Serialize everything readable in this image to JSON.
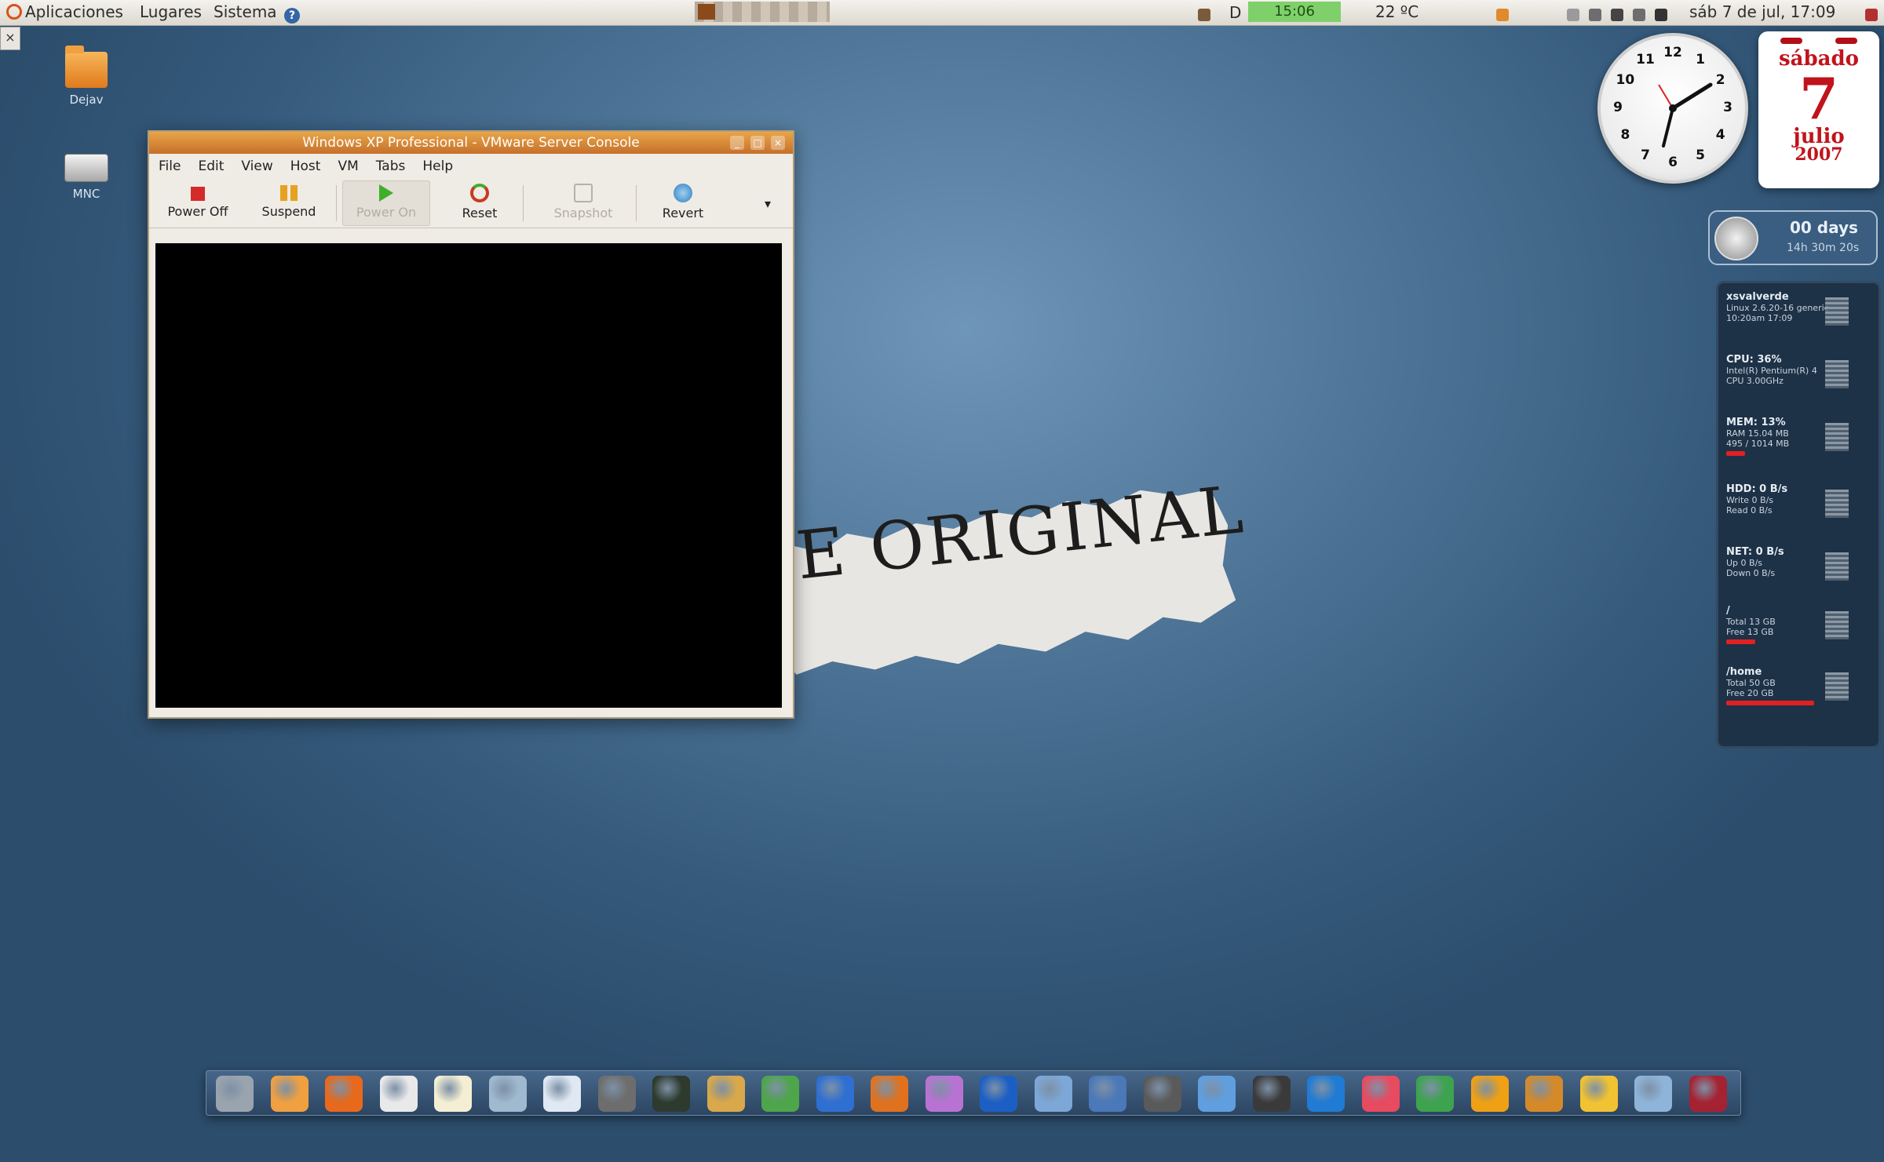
{
  "top_panel": {
    "menus": [
      "Aplicaciones",
      "Lugares",
      "Sistema"
    ],
    "net_speed": "15:06",
    "weather": "22 ºC",
    "datetime": "sáb  7 de jul, 17:09"
  },
  "desktop_icons": [
    {
      "label": "Dejav",
      "icon": "folder-icon"
    },
    {
      "label": "MNC",
      "icon": "drive-icon"
    }
  ],
  "vm_window": {
    "title": "Windows XP Professional - VMware Server Console",
    "menu": [
      "File",
      "Edit",
      "View",
      "Host",
      "VM",
      "Tabs",
      "Help"
    ],
    "toolbar": {
      "power_off": "Power Off",
      "suspend": "Suspend",
      "power_on": "Power On",
      "reset": "Reset",
      "snapshot": "Snapshot",
      "revert": "Revert"
    }
  },
  "wallpaper_text": "E ORIGINAL",
  "calendar": {
    "weekday": "sábado",
    "day": "7",
    "month": "julio",
    "year": "2007"
  },
  "uptime": {
    "days": "00 days",
    "detail": "14h 30m 20s"
  },
  "sysmon": {
    "sections": [
      {
        "head": "xsvalverde",
        "lines": [
          "Linux 2.6.20-16 generic",
          "10:20am 17:09"
        ],
        "bar": null
      },
      {
        "head": "CPU: 36%",
        "lines": [
          "Intel(R) Pentium(R) 4",
          "CPU 3.00GHz"
        ],
        "bar": null
      },
      {
        "head": "MEM: 13%",
        "lines": [
          "RAM 15.04 MB",
          "495 / 1014 MB"
        ],
        "bar": 0.13
      },
      {
        "head": "HDD: 0 B/s",
        "lines": [
          "Write 0 B/s",
          "Read 0 B/s"
        ],
        "bar": null
      },
      {
        "head": "NET: 0 B/s",
        "lines": [
          "Up 0 B/s",
          "Down 0 B/s"
        ],
        "bar": null
      },
      {
        "head": "/",
        "lines": [
          "Total 13 GB",
          "Free 13 GB"
        ],
        "bar": 0.2
      },
      {
        "head": "/home",
        "lines": [
          "Total 50 GB",
          "Free 20 GB"
        ],
        "bar": 0.6
      }
    ]
  },
  "dock": {
    "items": [
      {
        "name": "hand-tool",
        "color": "#9aa4ae"
      },
      {
        "name": "home-folder",
        "color": "#f0a040"
      },
      {
        "name": "firefox",
        "color": "#e8691c"
      },
      {
        "name": "mail",
        "color": "#e9e9e9"
      },
      {
        "name": "text-editor",
        "color": "#f4efd4"
      },
      {
        "name": "network",
        "color": "#9fb9cf"
      },
      {
        "name": "documents",
        "color": "#dfe8f3"
      },
      {
        "name": "calculator",
        "color": "#6d6d6d"
      },
      {
        "name": "terminal",
        "color": "#2d3a2d"
      },
      {
        "name": "media",
        "color": "#d9a84a"
      },
      {
        "name": "tools",
        "color": "#4ea54a"
      },
      {
        "name": "chat",
        "color": "#2f6fd2"
      },
      {
        "name": "feather",
        "color": "#e0721f"
      },
      {
        "name": "magnifier",
        "color": "#b873d2"
      },
      {
        "name": "globe",
        "color": "#1c5fc4"
      },
      {
        "name": "earth",
        "color": "#7da7d6"
      },
      {
        "name": "clock",
        "color": "#4a78b8"
      },
      {
        "name": "laptop",
        "color": "#5a5a5a"
      },
      {
        "name": "web",
        "color": "#5f9fe0"
      },
      {
        "name": "settings",
        "color": "#3a3a3a"
      },
      {
        "name": "photo",
        "color": "#1f7bd4"
      },
      {
        "name": "swirl",
        "color": "#e84a5f"
      },
      {
        "name": "palm",
        "color": "#3da34e"
      },
      {
        "name": "magnet",
        "color": "#f0a014"
      },
      {
        "name": "grid",
        "color": "#d58a2a"
      },
      {
        "name": "user",
        "color": "#f1c232"
      },
      {
        "name": "contacts",
        "color": "#8fb4d9"
      },
      {
        "name": "trash",
        "color": "#a52232"
      }
    ]
  }
}
